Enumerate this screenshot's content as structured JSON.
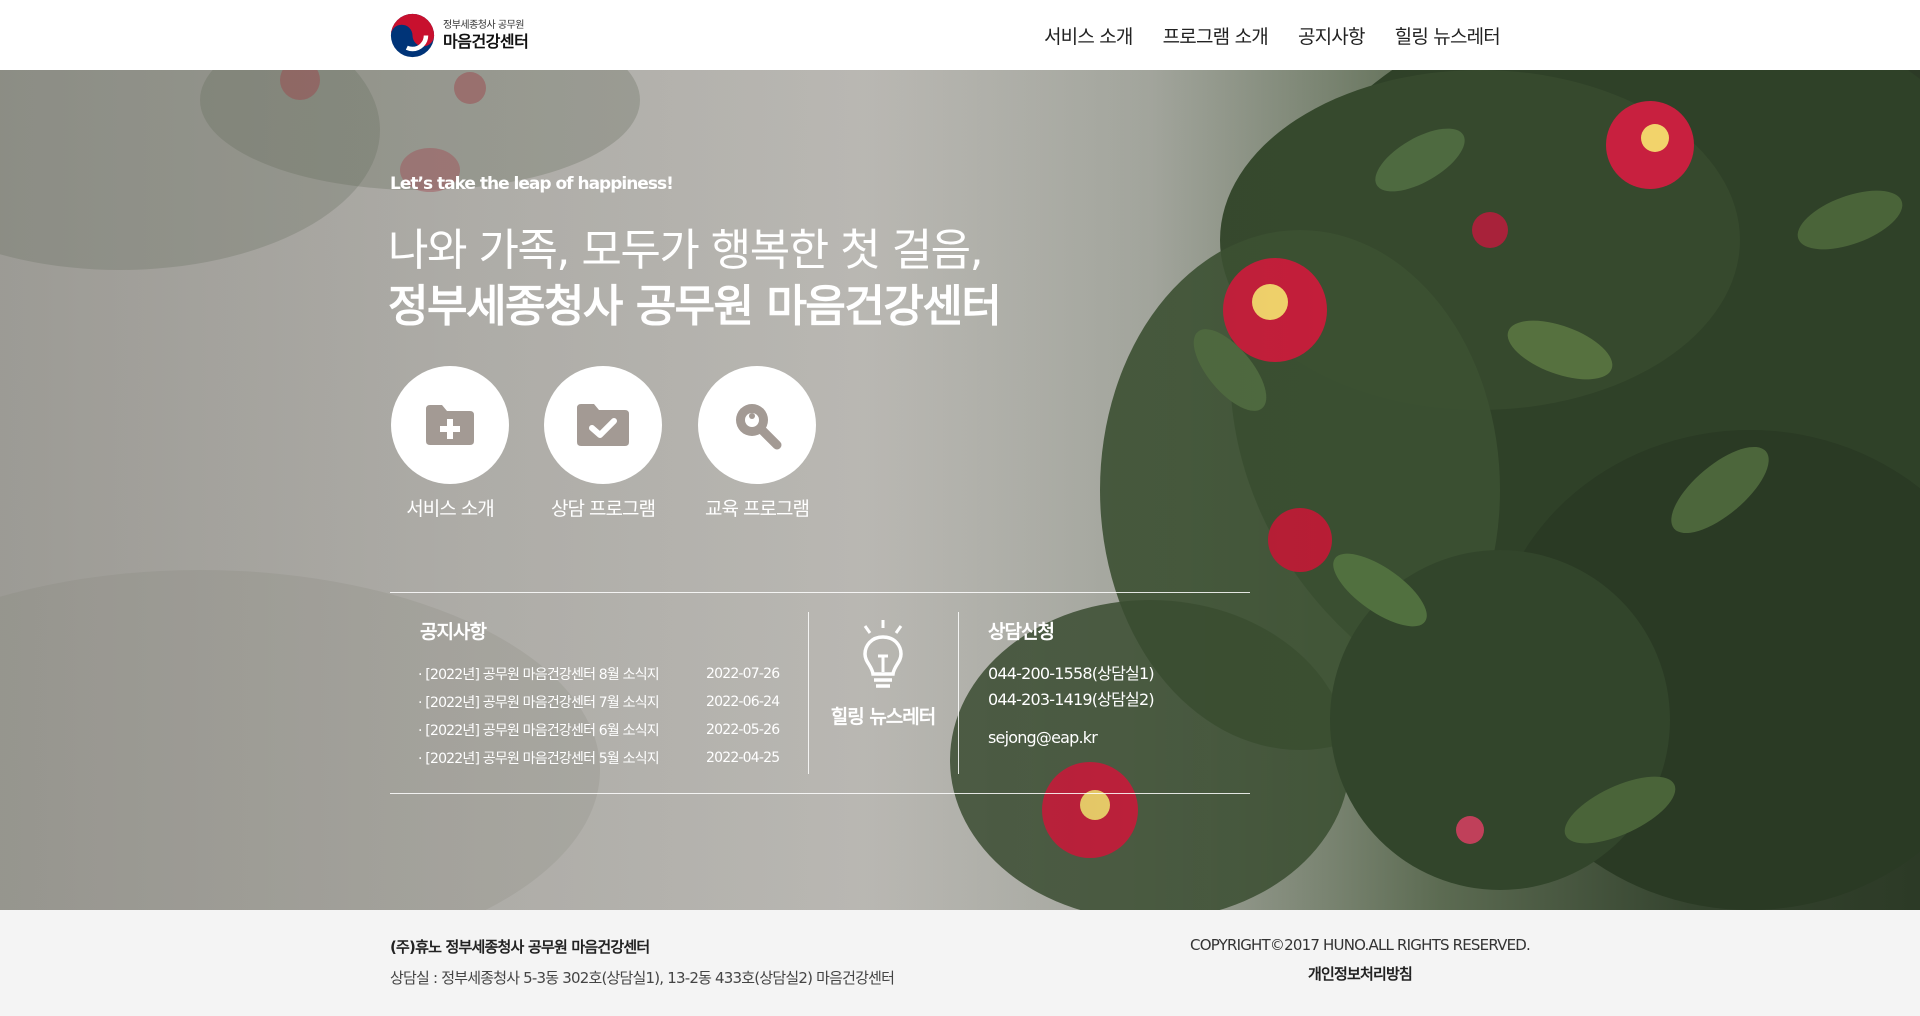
{
  "header": {
    "logo_sub": "정부세종청사 공무원",
    "logo_main": "마음건강센터",
    "nav": [
      "서비스 소개",
      "프로그램 소개",
      "공지사항",
      "힐링 뉴스레터"
    ]
  },
  "hero": {
    "tagline": "Let’s take the leap of happiness!",
    "title_line1": "나와 가족, 모두가 행복한 첫 걸음,",
    "title_line2": "정부세종청사 공무원 마음건강센터",
    "quick_links": [
      {
        "label": "서비스 소개",
        "icon": "folder-plus-icon"
      },
      {
        "label": "상담 프로그램",
        "icon": "folder-check-icon"
      },
      {
        "label": "교육 프로그램",
        "icon": "search-icon"
      }
    ]
  },
  "notice": {
    "title": "공지사항",
    "items": [
      {
        "text": "[2022년] 공무원 마음건강센터 8월 소식지",
        "date": "2022-07-26"
      },
      {
        "text": "[2022년] 공무원 마음건강센터 7월 소식지",
        "date": "2022-06-24"
      },
      {
        "text": "[2022년] 공무원 마음건강센터 6월 소식지",
        "date": "2022-05-26"
      },
      {
        "text": "[2022년] 공무원 마음건강센터 5월 소식지",
        "date": "2022-04-25"
      }
    ]
  },
  "newsletter": {
    "label": "힐링 뉴스레터",
    "icon": "lightbulb-icon"
  },
  "counsel": {
    "title": "상담신청",
    "phone1": "044-200-1558(상담실1)",
    "phone2": "044-203-1419(상담실2)",
    "email": "sejong@eap.kr"
  },
  "footer": {
    "company": "(주)휴노 정부세종청사 공무원 마음건강센터",
    "address": "상담실 : 정부세종청사 5-3동 302호(상담실1), 13-2동 433호(상담실2) 마음건강센터",
    "copyright": "COPYRIGHT©2017 HUNO.ALL RIGHTS RESERVED.",
    "privacy": "개인정보처리방침"
  },
  "colors": {
    "accent_red": "#c8102e",
    "accent_blue": "#003478",
    "icon_gray": "#a39a94"
  }
}
